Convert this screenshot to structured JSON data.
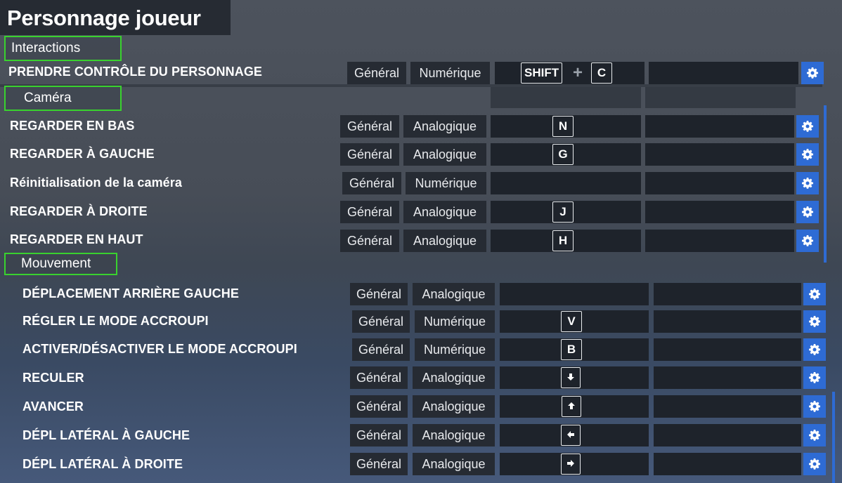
{
  "page_title": "Personnage joueur",
  "accent": "#2e6bd4",
  "section_border": "#39d22e",
  "sections": {
    "interactions": "Interactions",
    "camera": "Caméra",
    "mouvement": "Mouvement"
  },
  "rows": {
    "r0": {
      "label": "PRENDRE CONTRÔLE DU PERSONNAGE",
      "category": "Général",
      "type": "Numérique",
      "key1": "SHIFT",
      "key2": "C"
    },
    "r1": {
      "label": "REGARDER EN BAS",
      "category": "Général",
      "type": "Analogique",
      "key": "N"
    },
    "r2": {
      "label": "REGARDER À GAUCHE",
      "category": "Général",
      "type": "Analogique",
      "key": "G"
    },
    "r3": {
      "label": "Réinitialisation de la caméra",
      "category": "Général",
      "type": "Numérique"
    },
    "r4": {
      "label": "REGARDER À DROITE",
      "category": "Général",
      "type": "Analogique",
      "key": "J"
    },
    "r5": {
      "label": "REGARDER EN HAUT",
      "category": "Général",
      "type": "Analogique",
      "key": "H"
    },
    "r6": {
      "label": "DÉPLACEMENT ARRIÈRE GAUCHE",
      "category": "Général",
      "type": "Analogique"
    },
    "r7": {
      "label": "RÉGLER LE MODE ACCROUPI",
      "category": "Général",
      "type": "Numérique",
      "key": "V"
    },
    "r8": {
      "label": "ACTIVER/DÉSACTIVER LE MODE ACCROUPI",
      "category": "Général",
      "type": "Numérique",
      "key": "B"
    },
    "r9": {
      "label": "RECULER",
      "category": "Général",
      "type": "Analogique",
      "key": "arrow-down-icon"
    },
    "r10": {
      "label": "AVANCER",
      "category": "Général",
      "type": "Analogique",
      "key": "arrow-up-icon"
    },
    "r11": {
      "label": "DÉPL LATÉRAL À GAUCHE",
      "category": "Général",
      "type": "Analogique",
      "key": "arrow-left-icon"
    },
    "r12": {
      "label": "DÉPL LATÉRAL À DROITE",
      "category": "Général",
      "type": "Analogique",
      "key": "arrow-right-icon"
    }
  }
}
